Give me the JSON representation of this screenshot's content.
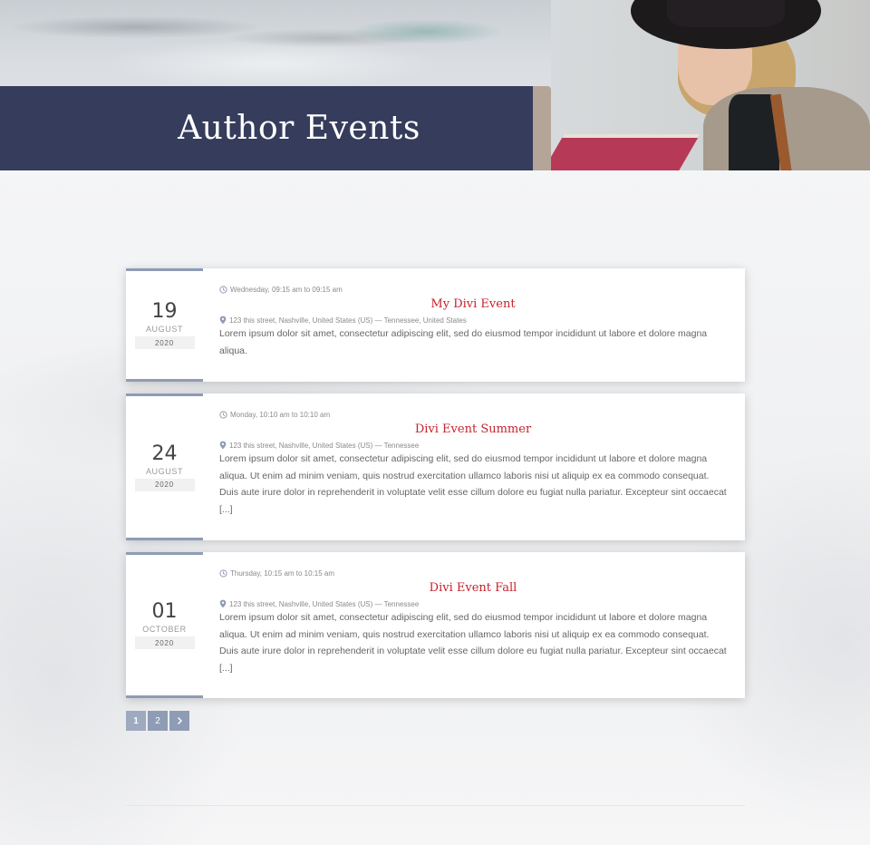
{
  "hero": {
    "title": "Author Events"
  },
  "events": [
    {
      "day": "19",
      "month": "AUGUST",
      "year": "2020",
      "time": "Wednesday, 09:15 am to 09:15 am",
      "title": "My Divi Event",
      "location": "123 this street, Nashville, United States (US) — Tennessee, United States",
      "description": "Lorem ipsum dolor sit amet, consectetur adipiscing elit, sed do eiusmod tempor incididunt ut labore et dolore magna aliqua."
    },
    {
      "day": "24",
      "month": "AUGUST",
      "year": "2020",
      "time": "Monday, 10:10 am to 10:10 am",
      "title": "Divi Event Summer",
      "location": "123 this street, Nashville, United States (US) — Tennessee",
      "description": "Lorem ipsum dolor sit amet, consectetur adipiscing elit, sed do eiusmod tempor incididunt ut labore et dolore magna aliqua. Ut enim ad minim veniam, quis nostrud exercitation ullamco laboris nisi ut aliquip ex ea commodo consequat. Duis aute irure dolor in reprehenderit in voluptate velit esse cillum dolore eu fugiat nulla pariatur. Excepteur sint occaecat [...]"
    },
    {
      "day": "01",
      "month": "OCTOBER",
      "year": "2020",
      "time": "Thursday, 10:15 am to 10:15 am",
      "title": "Divi Event Fall",
      "location": "123 this street, Nashville, United States (US) — Tennessee",
      "description": "Lorem ipsum dolor sit amet, consectetur adipiscing elit, sed do eiusmod tempor incididunt ut labore et dolore magna aliqua. Ut enim ad minim veniam, quis nostrud exercitation ullamco laboris nisi ut aliquip ex ea commodo consequat. Duis aute irure dolor in reprehenderit in voluptate velit esse cillum dolore eu fugiat nulla pariatur. Excepteur sint occaecat [...]"
    }
  ],
  "pagination": {
    "pages": [
      "1",
      "2"
    ],
    "current": "1",
    "next_symbol": "›"
  },
  "colors": {
    "title_band": "#363c5b",
    "accent": "#8e9cb5",
    "event_title": "#c6222d"
  },
  "icons": {
    "time": "clock-icon",
    "location": "map-pin-icon",
    "next": "chevron-right-icon"
  }
}
